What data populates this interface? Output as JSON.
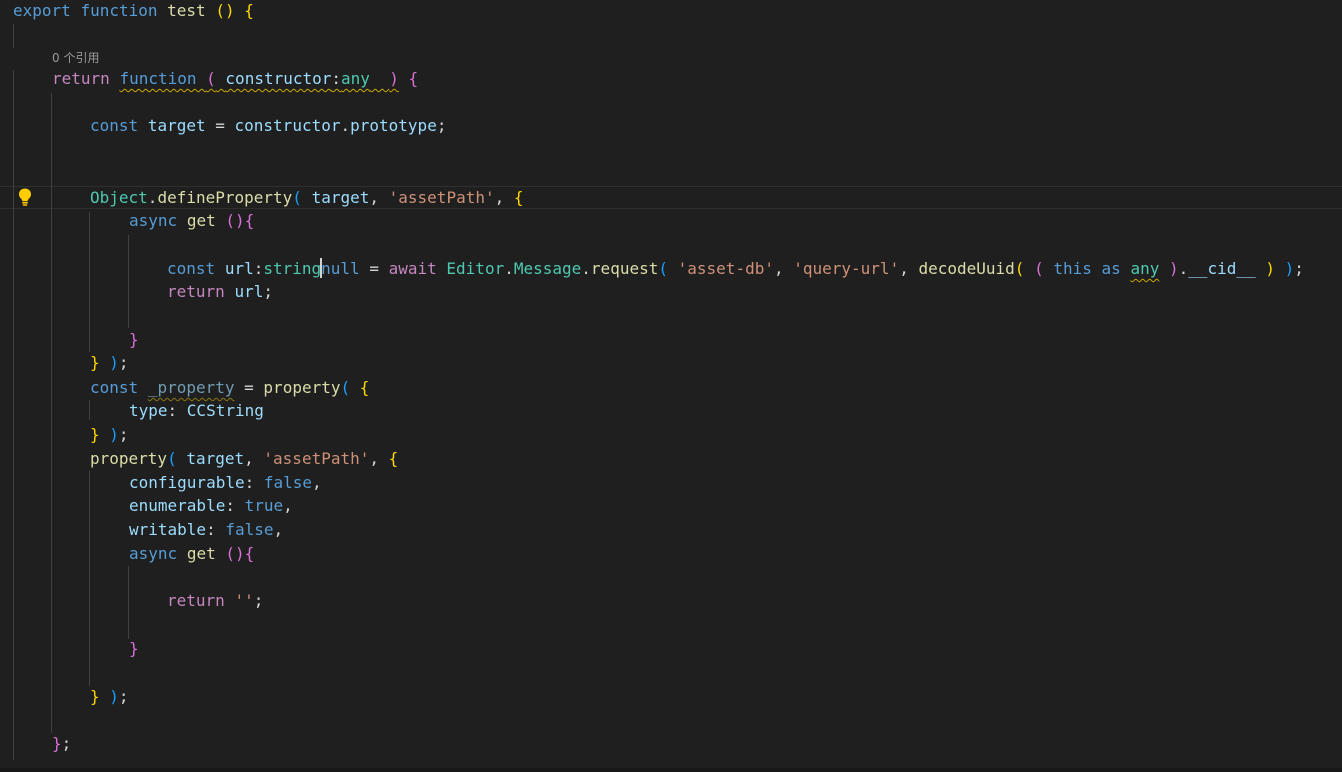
{
  "codelens": {
    "references": "0 个引用"
  },
  "colors": {
    "background": "#1f1f1f",
    "keyword": "#569cd6",
    "control": "#c586c0",
    "function": "#dcdcaa",
    "type": "#4ec9b0",
    "variable": "#9cdcfe",
    "string": "#ce9178",
    "text": "#d4d4d4",
    "bracket_gold": "#ffd700",
    "bracket_purple": "#da70d6",
    "bracket_blue": "#179fff",
    "warning": "#cca700"
  },
  "icons": {
    "lightbulb": "lightbulb-icon"
  },
  "code": {
    "l1": [
      "export",
      " ",
      "function",
      " ",
      "test",
      " ",
      "()",
      " ",
      "{"
    ],
    "l2": [
      "return",
      " ",
      "function",
      " ",
      "(",
      " ",
      "constructor",
      ":",
      "any",
      "  ",
      ")",
      " ",
      "{"
    ],
    "l3": [
      "const",
      " ",
      "target",
      " = ",
      "constructor",
      ".",
      "prototype",
      ";"
    ],
    "l4": [
      "Object",
      ".",
      "defineProperty",
      "(",
      " ",
      "target",
      ", ",
      "'assetPath'",
      ", ",
      "{"
    ],
    "l5": [
      "async",
      " ",
      "get",
      " ",
      "()",
      "{"
    ],
    "l6": [
      "const",
      " ",
      "url",
      ":",
      "string",
      "null",
      " = ",
      "await",
      " ",
      "Editor",
      ".",
      "Message",
      ".",
      "request",
      "(",
      " ",
      "'asset-db'",
      ", ",
      "'query-url'",
      ", ",
      "decodeUuid",
      "(",
      " ",
      "(",
      " ",
      "this",
      " ",
      "as",
      " ",
      "any",
      " ",
      ")",
      ".",
      "__cid__",
      " ",
      ")",
      " ",
      ")",
      ";"
    ],
    "l7": [
      "return",
      " ",
      "url",
      ";"
    ],
    "l8": [
      "}"
    ],
    "l9": [
      "}",
      " ",
      ")",
      ";"
    ],
    "l10": [
      "const",
      " ",
      "_property",
      " = ",
      "property",
      "(",
      " ",
      "{"
    ],
    "l11": [
      "type",
      ": ",
      "CCString"
    ],
    "l12": [
      "}",
      " ",
      ")",
      ";"
    ],
    "l13": [
      "property",
      "(",
      " ",
      "target",
      ", ",
      "'assetPath'",
      ", ",
      "{"
    ],
    "l14": [
      "configurable",
      ": ",
      "false",
      ","
    ],
    "l15": [
      "enumerable",
      ": ",
      "true",
      ","
    ],
    "l16": [
      "writable",
      ": ",
      "false",
      ","
    ],
    "l17": [
      "async",
      " ",
      "get",
      " ",
      "()",
      "{"
    ],
    "l18": [
      "return",
      " ",
      "''",
      ";"
    ],
    "l19": [
      "}"
    ],
    "l20": [
      "}",
      " ",
      ")",
      ";"
    ],
    "l21": [
      "}",
      ";"
    ]
  }
}
